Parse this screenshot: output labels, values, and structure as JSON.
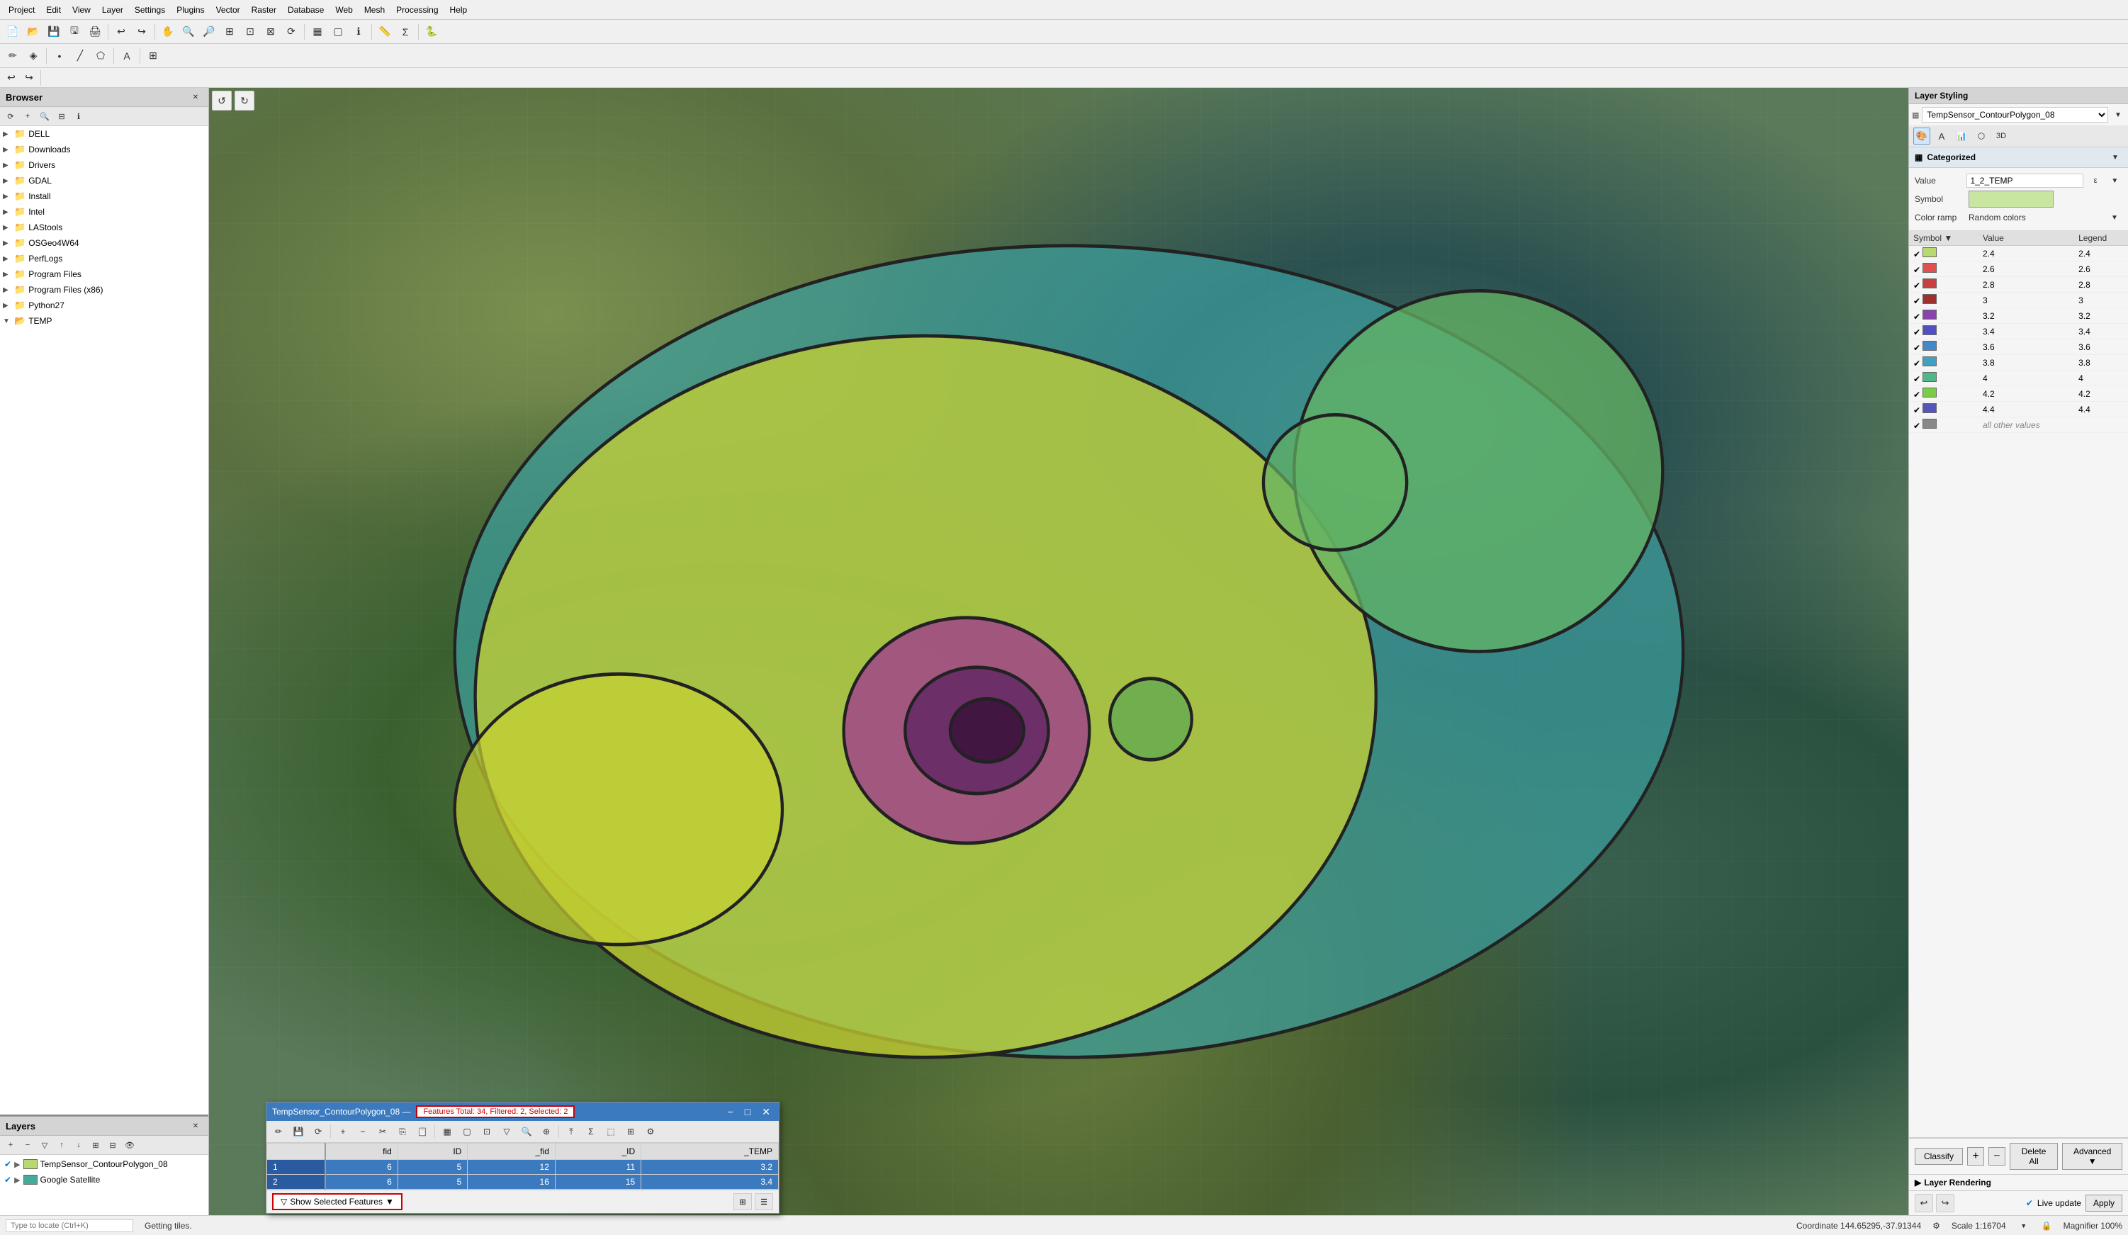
{
  "menubar": {
    "items": [
      "Project",
      "Edit",
      "View",
      "Layer",
      "Settings",
      "Plugins",
      "Vector",
      "Raster",
      "Database",
      "Web",
      "Mesh",
      "Processing",
      "Help"
    ]
  },
  "browser": {
    "title": "Browser",
    "items": [
      {
        "label": "DELL",
        "type": "folder",
        "expanded": false
      },
      {
        "label": "Downloads",
        "type": "folder",
        "expanded": false
      },
      {
        "label": "Drivers",
        "type": "folder",
        "expanded": false
      },
      {
        "label": "GDAL",
        "type": "folder",
        "expanded": false
      },
      {
        "label": "Install",
        "type": "folder",
        "expanded": false
      },
      {
        "label": "Intel",
        "type": "folder",
        "expanded": false
      },
      {
        "label": "LAStools",
        "type": "folder",
        "expanded": false
      },
      {
        "label": "OSGeo4W64",
        "type": "folder",
        "expanded": false
      },
      {
        "label": "PerfLogs",
        "type": "folder",
        "expanded": false
      },
      {
        "label": "Program Files",
        "type": "folder",
        "expanded": false
      },
      {
        "label": "Program Files (x86)",
        "type": "folder",
        "expanded": false
      },
      {
        "label": "Python27",
        "type": "folder",
        "expanded": false
      },
      {
        "label": "TEMP",
        "type": "folder",
        "expanded": true
      }
    ]
  },
  "layers": {
    "title": "Layers",
    "items": [
      {
        "label": "TempSensor_ContourPolygon_08",
        "visible": true,
        "type": "vector"
      },
      {
        "label": "Google Satellite",
        "visible": true,
        "type": "raster"
      }
    ]
  },
  "statusbar": {
    "locate_placeholder": "Type to locate (Ctrl+K)",
    "getting_tiles": "Getting tiles.",
    "coordinate": "Coordinate 144.65295,-37.91344",
    "scale_label": "Scale 1:16704",
    "magnifier": "Magnifier 100%"
  },
  "layer_styling": {
    "title": "Layer Styling",
    "layer_name": "TempSensor_ContourPolygon_08",
    "renderer": "Categorized",
    "value_label": "Value",
    "value": "1_2_TEMP",
    "symbol_label": "Symbol",
    "color_ramp_label": "Color ramp",
    "color_ramp_value": "Random colors",
    "table_headers": [
      "Symbol",
      "Value",
      "Legend"
    ],
    "rows": [
      {
        "value": "2.4",
        "legend": "2.4",
        "color": "#b8d870"
      },
      {
        "value": "2.6",
        "legend": "2.6",
        "color": "#e05050"
      },
      {
        "value": "2.8",
        "legend": "2.8",
        "color": "#c84040"
      },
      {
        "value": "3",
        "legend": "3",
        "color": "#a03030"
      },
      {
        "value": "3.2",
        "legend": "3.2",
        "color": "#8844aa"
      },
      {
        "value": "3.4",
        "legend": "3.4",
        "color": "#5050c0"
      },
      {
        "value": "3.6",
        "legend": "3.6",
        "color": "#4488cc"
      },
      {
        "value": "3.8",
        "legend": "3.8",
        "color": "#40a0c0"
      },
      {
        "value": "4",
        "legend": "4",
        "color": "#50b888"
      },
      {
        "value": "4.2",
        "legend": "4.2",
        "color": "#7acc44"
      },
      {
        "value": "4.4",
        "legend": "4.4",
        "color": "#5555bb"
      },
      {
        "value": "all other values",
        "legend": "",
        "color": "#888888"
      }
    ],
    "classify_label": "Classify",
    "delete_all_label": "Delete All",
    "advanced_label": "Advanced",
    "layer_rendering_label": "Layer Rendering",
    "live_update_label": "Live update",
    "apply_label": "Apply"
  },
  "attr_table": {
    "title": "TempSensor_ContourPolygon_08 —",
    "filter_status": "Features Total: 34, Filtered: 2, Selected: 2",
    "columns": [
      "fid",
      "ID",
      "_fid",
      "_ID",
      "_TEMP"
    ],
    "rows": [
      {
        "num": 1,
        "fid": 6,
        "id": 5,
        "_fid": 12,
        "_id": 11,
        "_temp": 3.2
      },
      {
        "num": 2,
        "fid": 6,
        "id": 5,
        "_fid": 16,
        "_id": 15,
        "_temp": 3.4
      }
    ],
    "show_selected_label": "Show Selected Features",
    "show_selected_icon": "▼"
  }
}
